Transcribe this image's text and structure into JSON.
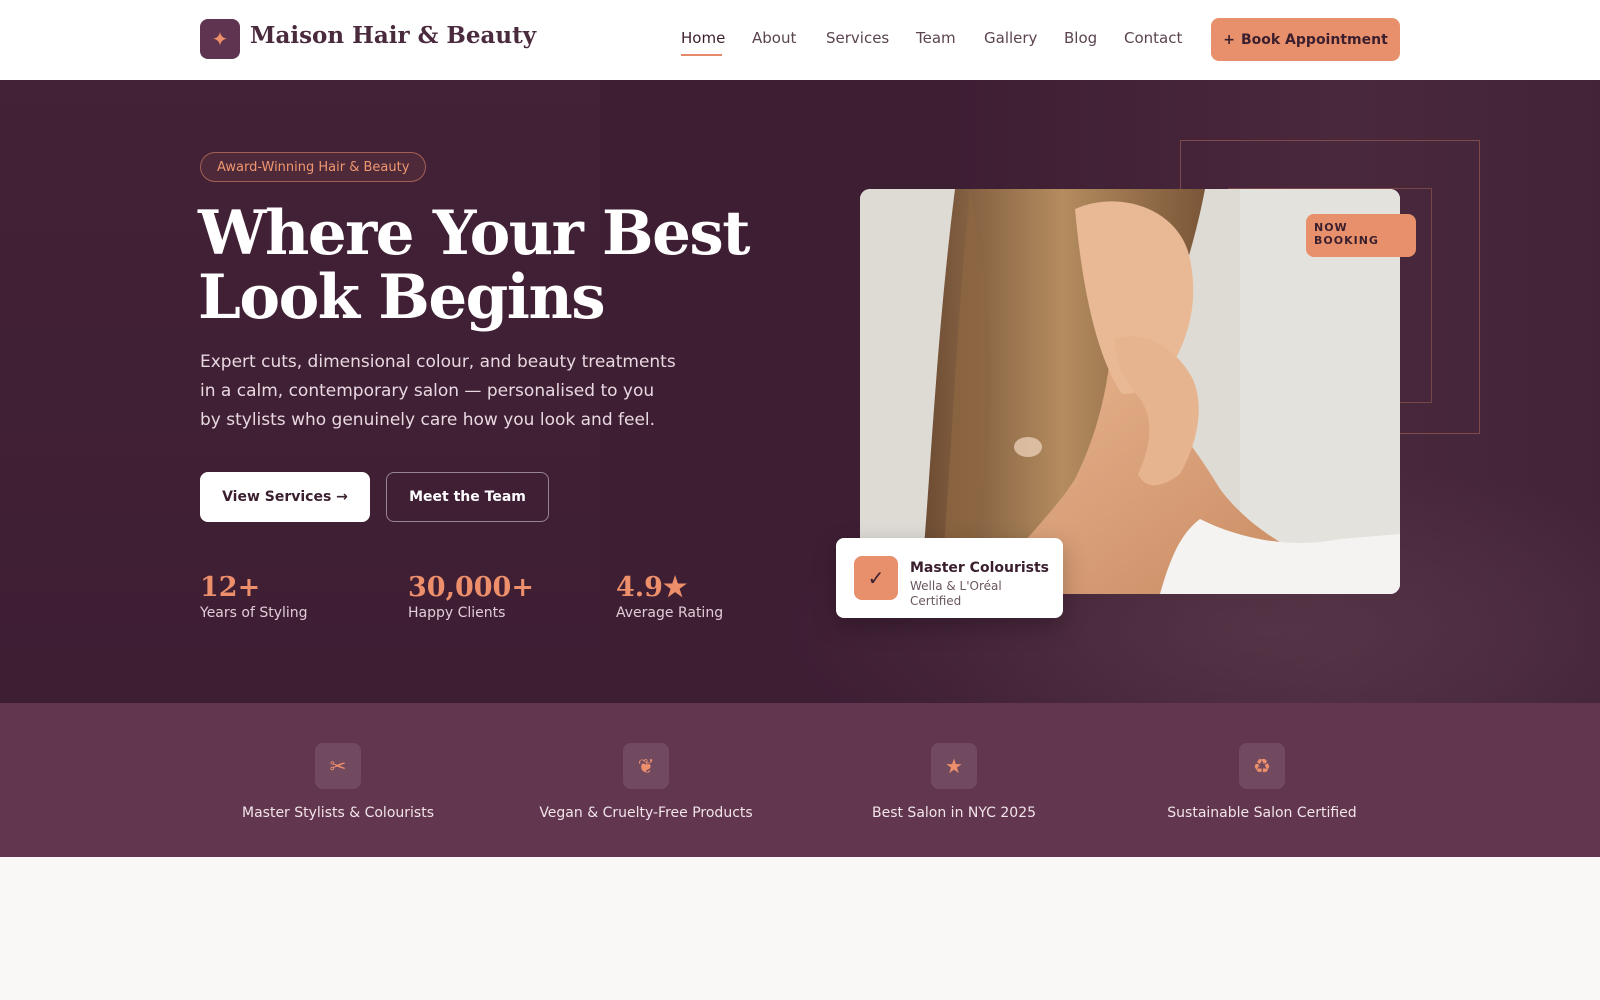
{
  "header": {
    "logo_icon": "sparkle-icon",
    "logo_glyph": "✦",
    "brand": "Maison Hair & Beauty",
    "nav": [
      "Home",
      "About",
      "Services",
      "Team",
      "Gallery",
      "Blog",
      "Contact"
    ],
    "active_nav": "Home",
    "book_icon": "plus-icon",
    "book_glyph": "+",
    "book_label": "Book Appointment"
  },
  "hero": {
    "badge": "Award-Winning Hair & Beauty",
    "title": "Where Your Best Look Begins",
    "description": "Expert cuts, dimensional colour, and beauty treatments in a calm, contemporary salon — personalised to you by stylists who genuinely care how you look and feel.",
    "primary_button": "View Services →",
    "secondary_button": "Meet the Team",
    "stats": [
      {
        "value": "12+",
        "label": "Years of Styling"
      },
      {
        "value": "30,000+",
        "label": "Happy Clients"
      },
      {
        "value": "4.9★",
        "label": "Average Rating"
      }
    ],
    "booking_badge": "NOW BOOKING",
    "cert_card": {
      "icon": "check-icon",
      "glyph": "✓",
      "title": "Master Colourists",
      "subtitle": "Wella & L'Oréal Certified"
    }
  },
  "features": [
    {
      "icon": "scissors-icon",
      "glyph": "✂",
      "label": "Master Stylists & Colourists"
    },
    {
      "icon": "leaf-icon",
      "glyph": "❦",
      "label": "Vegan & Cruelty-Free Products"
    },
    {
      "icon": "star-icon",
      "glyph": "★",
      "label": "Best Salon in NYC 2025"
    },
    {
      "icon": "recycle-icon",
      "glyph": "♻",
      "label": "Sustainable Salon Certified"
    }
  ],
  "colors": {
    "accent": "#e8906b",
    "hero_bg": "#3e1e33",
    "band_bg": "#62364e",
    "brand_dark": "#5e3450"
  }
}
